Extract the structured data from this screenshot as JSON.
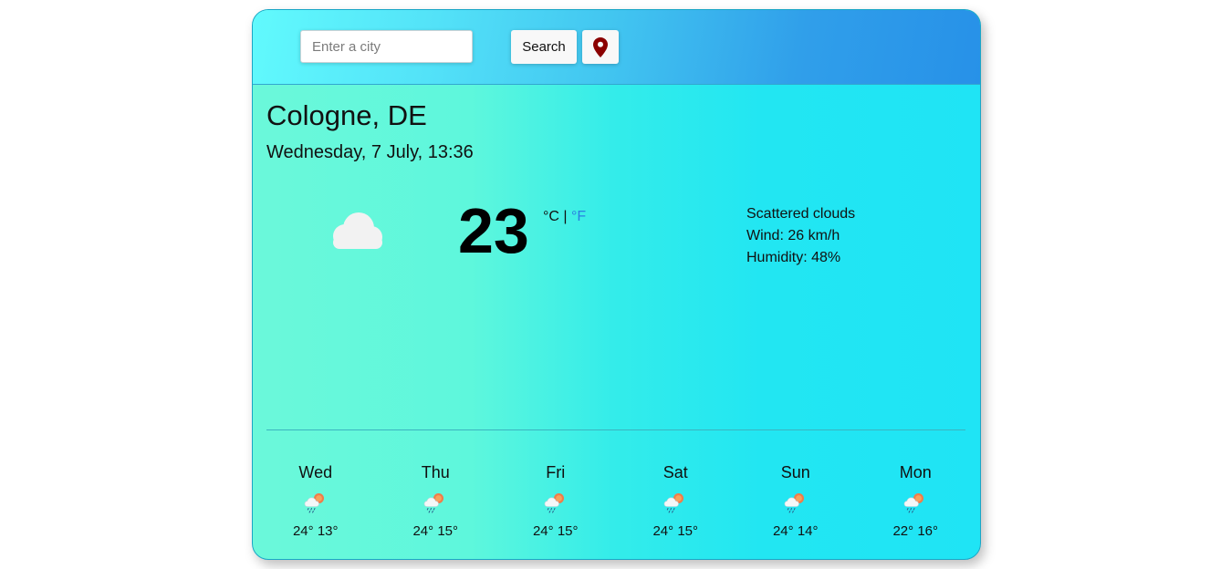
{
  "search": {
    "placeholder": "Enter a city",
    "value": "",
    "button_label": "Search",
    "location_icon": "map-pin-icon",
    "location_color": "#8b0000"
  },
  "current": {
    "city": "Cologne, DE",
    "datetime": "Wednesday, 7 July, 13:36",
    "icon": "cloud-icon",
    "temperature": "23",
    "unit_c": "°C",
    "unit_separator": "|",
    "unit_f": "°F",
    "description": "Scattered clouds",
    "wind": "Wind: 26 km/h",
    "humidity": "Humidity: 48%"
  },
  "forecast": [
    {
      "day": "Wed",
      "icon": "rain-sun-cloud-icon",
      "temps": "24° 13°"
    },
    {
      "day": "Thu",
      "icon": "rain-sun-cloud-icon",
      "temps": "24° 15°"
    },
    {
      "day": "Fri",
      "icon": "rain-sun-cloud-icon",
      "temps": "24° 15°"
    },
    {
      "day": "Sat",
      "icon": "rain-sun-cloud-icon",
      "temps": "24° 15°"
    },
    {
      "day": "Sun",
      "icon": "rain-sun-cloud-icon",
      "temps": "24° 14°"
    },
    {
      "day": "Mon",
      "icon": "rain-sun-cloud-icon",
      "temps": "22° 16°"
    }
  ],
  "colors": {
    "header_start": "#61fafd",
    "header_end": "#2791e8",
    "body_start": "#6bf8da",
    "body_end": "#1fe4f5",
    "unit_f": "#2a7fe0"
  }
}
